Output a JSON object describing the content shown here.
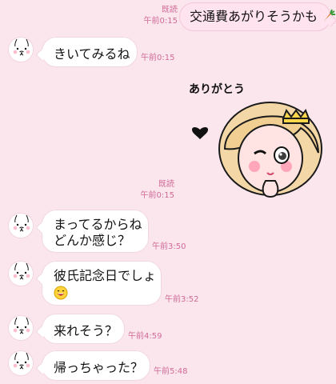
{
  "messages": [
    {
      "from": "me",
      "read_label": "既読",
      "time": "午前0:15",
      "text": "交通費あがりそうかも",
      "emoji": "carrot-icon"
    },
    {
      "from": "other",
      "time": "午前0:15",
      "text": "きいてみるね"
    },
    {
      "from": "me",
      "read_label": "既読",
      "time": "午前0:15",
      "sticker_text": "ありがとう"
    },
    {
      "from": "other",
      "time": "午前3:50",
      "lines": [
        "まってるからね",
        "どんか感じ？"
      ]
    },
    {
      "from": "other",
      "time": "午前3:52",
      "text": "彼氏記念日でしょ",
      "emoji": "laughing-face-icon"
    },
    {
      "from": "other",
      "time": "午前4:59",
      "text": "来れそう？"
    },
    {
      "from": "other",
      "time": "午前5:48",
      "text": "帰っちゃった？"
    }
  ],
  "colors": {
    "background": "#fbe6ee",
    "outgoing_bubble": "#ffe3ee",
    "incoming_bubble": "#ffffff",
    "meta_text": "#d06a95"
  }
}
